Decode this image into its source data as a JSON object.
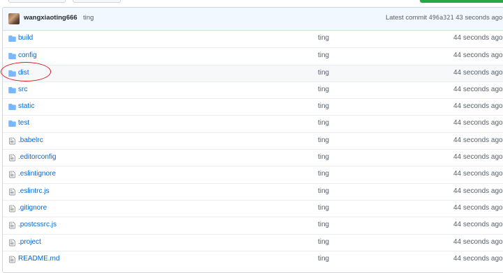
{
  "commit": {
    "author": "wangxiaoting666",
    "message": "ting",
    "latest_label": "Latest commit",
    "sha": "496a321",
    "age": "43 seconds ago"
  },
  "files": [
    {
      "name": "build",
      "type": "folder",
      "message": "ting",
      "age": "44 seconds ago"
    },
    {
      "name": "config",
      "type": "folder",
      "message": "ting",
      "age": "44 seconds ago"
    },
    {
      "name": "dist",
      "type": "folder",
      "message": "ting",
      "age": "44 seconds ago"
    },
    {
      "name": "src",
      "type": "folder",
      "message": "ting",
      "age": "44 seconds ago"
    },
    {
      "name": "static",
      "type": "folder",
      "message": "ting",
      "age": "44 seconds ago"
    },
    {
      "name": "test",
      "type": "folder",
      "message": "ting",
      "age": "44 seconds ago"
    },
    {
      "name": ".babelrc",
      "type": "file",
      "message": "ting",
      "age": "44 seconds ago"
    },
    {
      "name": ".editorconfig",
      "type": "file",
      "message": "ting",
      "age": "44 seconds ago"
    },
    {
      "name": ".eslintignore",
      "type": "file",
      "message": "ting",
      "age": "44 seconds ago"
    },
    {
      "name": ".eslintrc.js",
      "type": "file",
      "message": "ting",
      "age": "44 seconds ago"
    },
    {
      "name": ".gitignore",
      "type": "file",
      "message": "ting",
      "age": "44 seconds ago"
    },
    {
      "name": ".postcssrc.js",
      "type": "file",
      "message": "ting",
      "age": "44 seconds ago"
    },
    {
      "name": ".project",
      "type": "file",
      "message": "ting",
      "age": "44 seconds ago"
    },
    {
      "name": "README.md",
      "type": "file",
      "message": "ting",
      "age": "44 seconds ago"
    }
  ],
  "colors": {
    "link": "#0366d6",
    "folder_icon": "#79b8ff",
    "file_icon": "#6a737d",
    "annotation": "#e0141e"
  }
}
